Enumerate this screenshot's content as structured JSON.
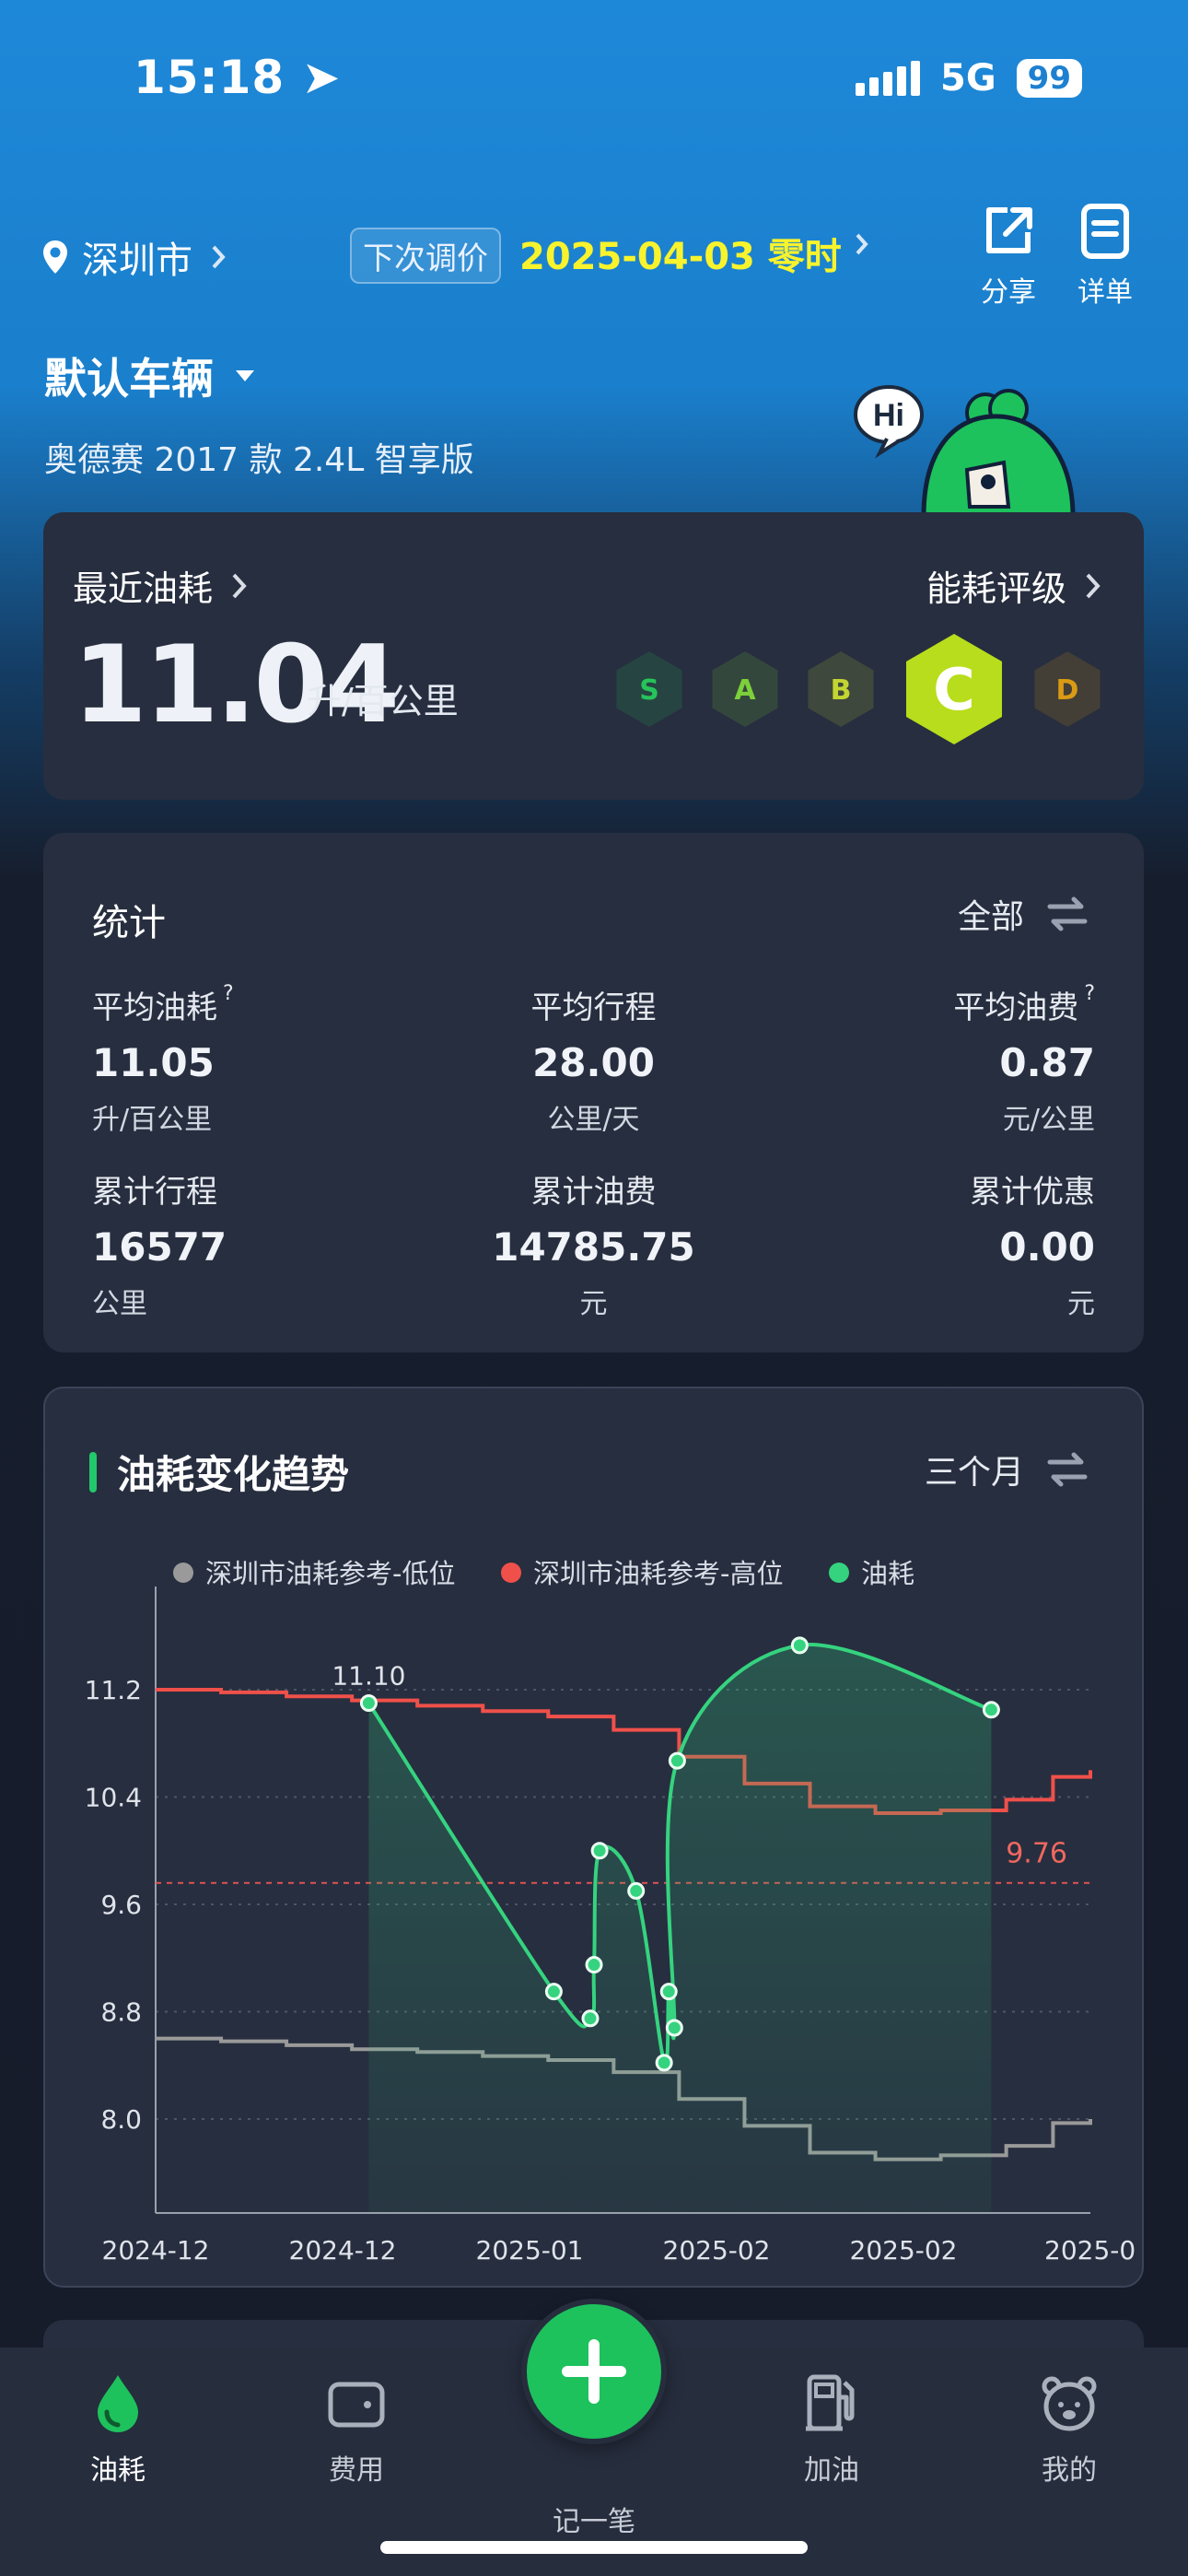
{
  "status_bar": {
    "time": "15:18",
    "network": "5G",
    "battery": "99"
  },
  "header": {
    "city": "深圳市",
    "price_label": "下次调价",
    "price_date": "2025-04-03 零时",
    "share_label": "分享",
    "detail_label": "详单"
  },
  "vehicle": {
    "name": "默认车辆",
    "model": "奥德赛 2017 款 2.4L 智享版"
  },
  "mascot": {
    "bubble": "Hi"
  },
  "fuel": {
    "recent_label": "最近油耗",
    "value": "11.04",
    "unit": "升/百公里",
    "rating_label": "能耗评级",
    "grades": [
      "S",
      "A",
      "B",
      "C",
      "D"
    ],
    "current_grade": "C",
    "colors": {
      "S": "#27c35a",
      "A": "#7cd03a",
      "B": "#c3d531",
      "C": "#b8dd1c",
      "D": "#d99a14"
    }
  },
  "stats": {
    "title": "统计",
    "filter": "全部",
    "avg_consumption": {
      "label": "平均油耗",
      "value": "11.05",
      "unit": "升/百公里",
      "help": "?"
    },
    "avg_distance": {
      "label": "平均行程",
      "value": "28.00",
      "unit": "公里/天"
    },
    "avg_cost": {
      "label": "平均油费",
      "value": "0.87",
      "unit": "元/公里",
      "help": "?"
    },
    "total_distance": {
      "label": "累计行程",
      "value": "16577",
      "unit": "公里"
    },
    "total_cost": {
      "label": "累计油费",
      "value": "14785.75",
      "unit": "元"
    },
    "total_discount": {
      "label": "累计优惠",
      "value": "0.00",
      "unit": "元"
    }
  },
  "trend": {
    "title": "油耗变化趋势",
    "filter": "三个月"
  },
  "chart_data": {
    "type": "line",
    "title": "油耗变化趋势",
    "legend_position": "top",
    "ylim": [
      7.3,
      11.9
    ],
    "yticks": [
      "11.2",
      "10.4",
      "9.6",
      "8.8",
      "8.0"
    ],
    "ytick_values": [
      11.2,
      10.4,
      9.6,
      8.8,
      8.0
    ],
    "xticks": [
      "2024-12",
      "2024-12",
      "2025-01",
      "2025-02",
      "2025-02",
      "2025-0"
    ],
    "grid": true,
    "reference_line": {
      "value": 9.76,
      "label": "9.76",
      "color": "#e05252"
    },
    "series": [
      {
        "name": "深圳市油耗参考-低位",
        "color": "#9a9a9a",
        "type": "step",
        "x": [
          0,
          0.07,
          0.14,
          0.21,
          0.28,
          0.35,
          0.42,
          0.49,
          0.56,
          0.63,
          0.7,
          0.77,
          0.84,
          0.91,
          0.96,
          1.0
        ],
        "y": [
          8.6,
          8.58,
          8.55,
          8.52,
          8.5,
          8.47,
          8.44,
          8.35,
          8.15,
          7.95,
          7.75,
          7.7,
          7.73,
          7.8,
          7.97,
          8.0
        ]
      },
      {
        "name": "深圳市油耗参考-高位",
        "color": "#f0504a",
        "type": "step",
        "x": [
          0,
          0.07,
          0.14,
          0.21,
          0.28,
          0.35,
          0.42,
          0.49,
          0.56,
          0.63,
          0.7,
          0.77,
          0.84,
          0.91,
          0.96,
          1.0
        ],
        "y": [
          11.2,
          11.18,
          11.15,
          11.12,
          11.08,
          11.04,
          11.0,
          10.9,
          10.7,
          10.5,
          10.33,
          10.28,
          10.3,
          10.38,
          10.55,
          10.6
        ]
      },
      {
        "name": "油耗",
        "color": "#35d37f",
        "type": "line",
        "x": [
          0.228,
          0.426,
          0.465,
          0.469,
          0.475,
          0.514,
          0.544,
          0.549,
          0.555,
          0.558,
          0.689,
          0.894
        ],
        "y": [
          11.1,
          8.95,
          8.75,
          9.15,
          10.0,
          9.7,
          8.42,
          8.95,
          8.68,
          10.67,
          11.53,
          11.05
        ],
        "labels": {
          "0": "11.10"
        }
      }
    ]
  },
  "nav": {
    "fuel": "油耗",
    "cost": "费用",
    "add": "记一笔",
    "refuel": "加油",
    "mine": "我的"
  }
}
